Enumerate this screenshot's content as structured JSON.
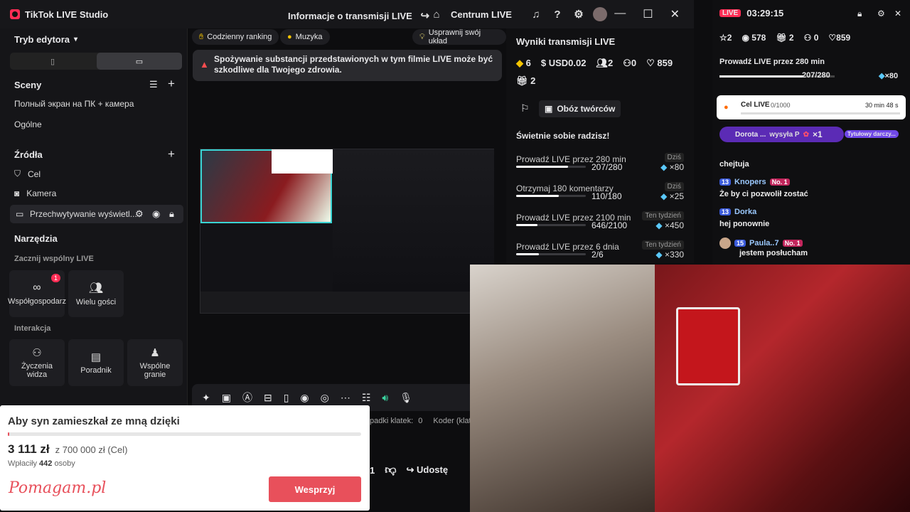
{
  "app": {
    "title": "TikTok LIVE Studio",
    "center_title": "Informacje o transmisji LIVE",
    "center_hub": "Centrum LIVE"
  },
  "left": {
    "editor_mode": "Tryb edytora",
    "scenes_title": "Sceny",
    "scenes": [
      "Полный экран на ПК + камера",
      "Ogólne"
    ],
    "sources_title": "Źródła",
    "sources": [
      {
        "label": "Cel",
        "icon": "shield-icon"
      },
      {
        "label": "Kamera",
        "icon": "camera-icon"
      },
      {
        "label": "Przechwytywanie wyświetl...",
        "icon": "monitor-icon"
      }
    ],
    "tools_title": "Narzędzia",
    "joint_live_title": "Zacznij wspólny LIVE",
    "cohost": "Współgospodarz",
    "cohost_badge": "1",
    "multi_guest": "Wielu gości",
    "interaction_title": "Interakcja",
    "wishes": "Życzenia widza",
    "guide": "Poradnik",
    "joint_play": "Wspólne granie"
  },
  "topchips": {
    "ranking": "Codzienny ranking",
    "music": "Muzyka",
    "improve": "Usprawnij swój układ"
  },
  "warning": "Spożywanie substancji przedstawionych w tym filmie LIVE może być szkodliwe dla Twojego zdrowia.",
  "statusline": {
    "frames_label": "padki klatek:",
    "frames_value": "0",
    "encoder": "Koder (klatki/s"
  },
  "results": {
    "title": "Wyniki transmisji LIVE",
    "diamonds": "6",
    "usd": "USD0.02",
    "viewers": "2",
    "new_followers": "0",
    "likes": "859",
    "gifts": "2",
    "camp": "Obóz twórców",
    "fun_title": "Świetnie sobie radzisz!",
    "goals": [
      {
        "name": "Prowadź LIVE przez 280 min",
        "tag": "Dziś",
        "value": "207/280",
        "progress": 0.74,
        "reward": "×80"
      },
      {
        "name": "Otrzymaj 180 komentarzy",
        "tag": "Dziś",
        "value": "110/180",
        "progress": 0.61,
        "reward": "×25"
      },
      {
        "name": "Prowadź LIVE przez 2100 min",
        "tag": "Ten tydzień",
        "value": "646/2100",
        "progress": 0.31,
        "reward": "×450"
      },
      {
        "name": "Prowadź LIVE przez 6 dnia",
        "tag": "Ten tydzień",
        "value": "2/6",
        "progress": 0.33,
        "reward": "×330"
      }
    ]
  },
  "chat": {
    "live_badge": "LIVE",
    "time": "03:29:15",
    "stars": "2",
    "viewers": "578",
    "gifts": "2",
    "follows": "0",
    "likes": "859",
    "goal_title": "Prowadź LIVE przez 280 min",
    "goal_value": "207/280",
    "goal_reward": "×80",
    "live_goal": "Cel LIVE",
    "live_goal_value": "0/1000",
    "live_goal_time": "30 min 48 s",
    "gift_user": "Dorota ...",
    "gift_text": "wysyła P",
    "gift_count": "×1",
    "gift_tag": "Tytułowy darczy...",
    "messages": [
      {
        "user": "",
        "text": "chejtuja"
      },
      {
        "user": "Knopers",
        "level": "13",
        "badge": "No. 1",
        "text": "Że by ci pozwolił zostać"
      },
      {
        "user": "Dorka",
        "level": "13",
        "text": "hej ponownie"
      },
      {
        "user": "Paula..7",
        "level": "15",
        "badge": "No. 1",
        "text": "jestem posłucham"
      }
    ]
  },
  "donation": {
    "title": "Aby syn zamieszkał ze mną dzięki",
    "amount": "3 111 zł",
    "target": "z 700 000 zł (Cel)",
    "payers_label": "Wpłaciły",
    "payers_count": "442",
    "payers_unit": "osoby",
    "progress": 0.004,
    "brand": "Pomagam.pl",
    "button": "Wesprzyj"
  },
  "bottom": {
    "share": "Udostę",
    "count": "1"
  },
  "colors": {
    "accent": "#ff2d55",
    "donate_button": "#e8505b",
    "warning_icon": "#ff4d4f"
  }
}
